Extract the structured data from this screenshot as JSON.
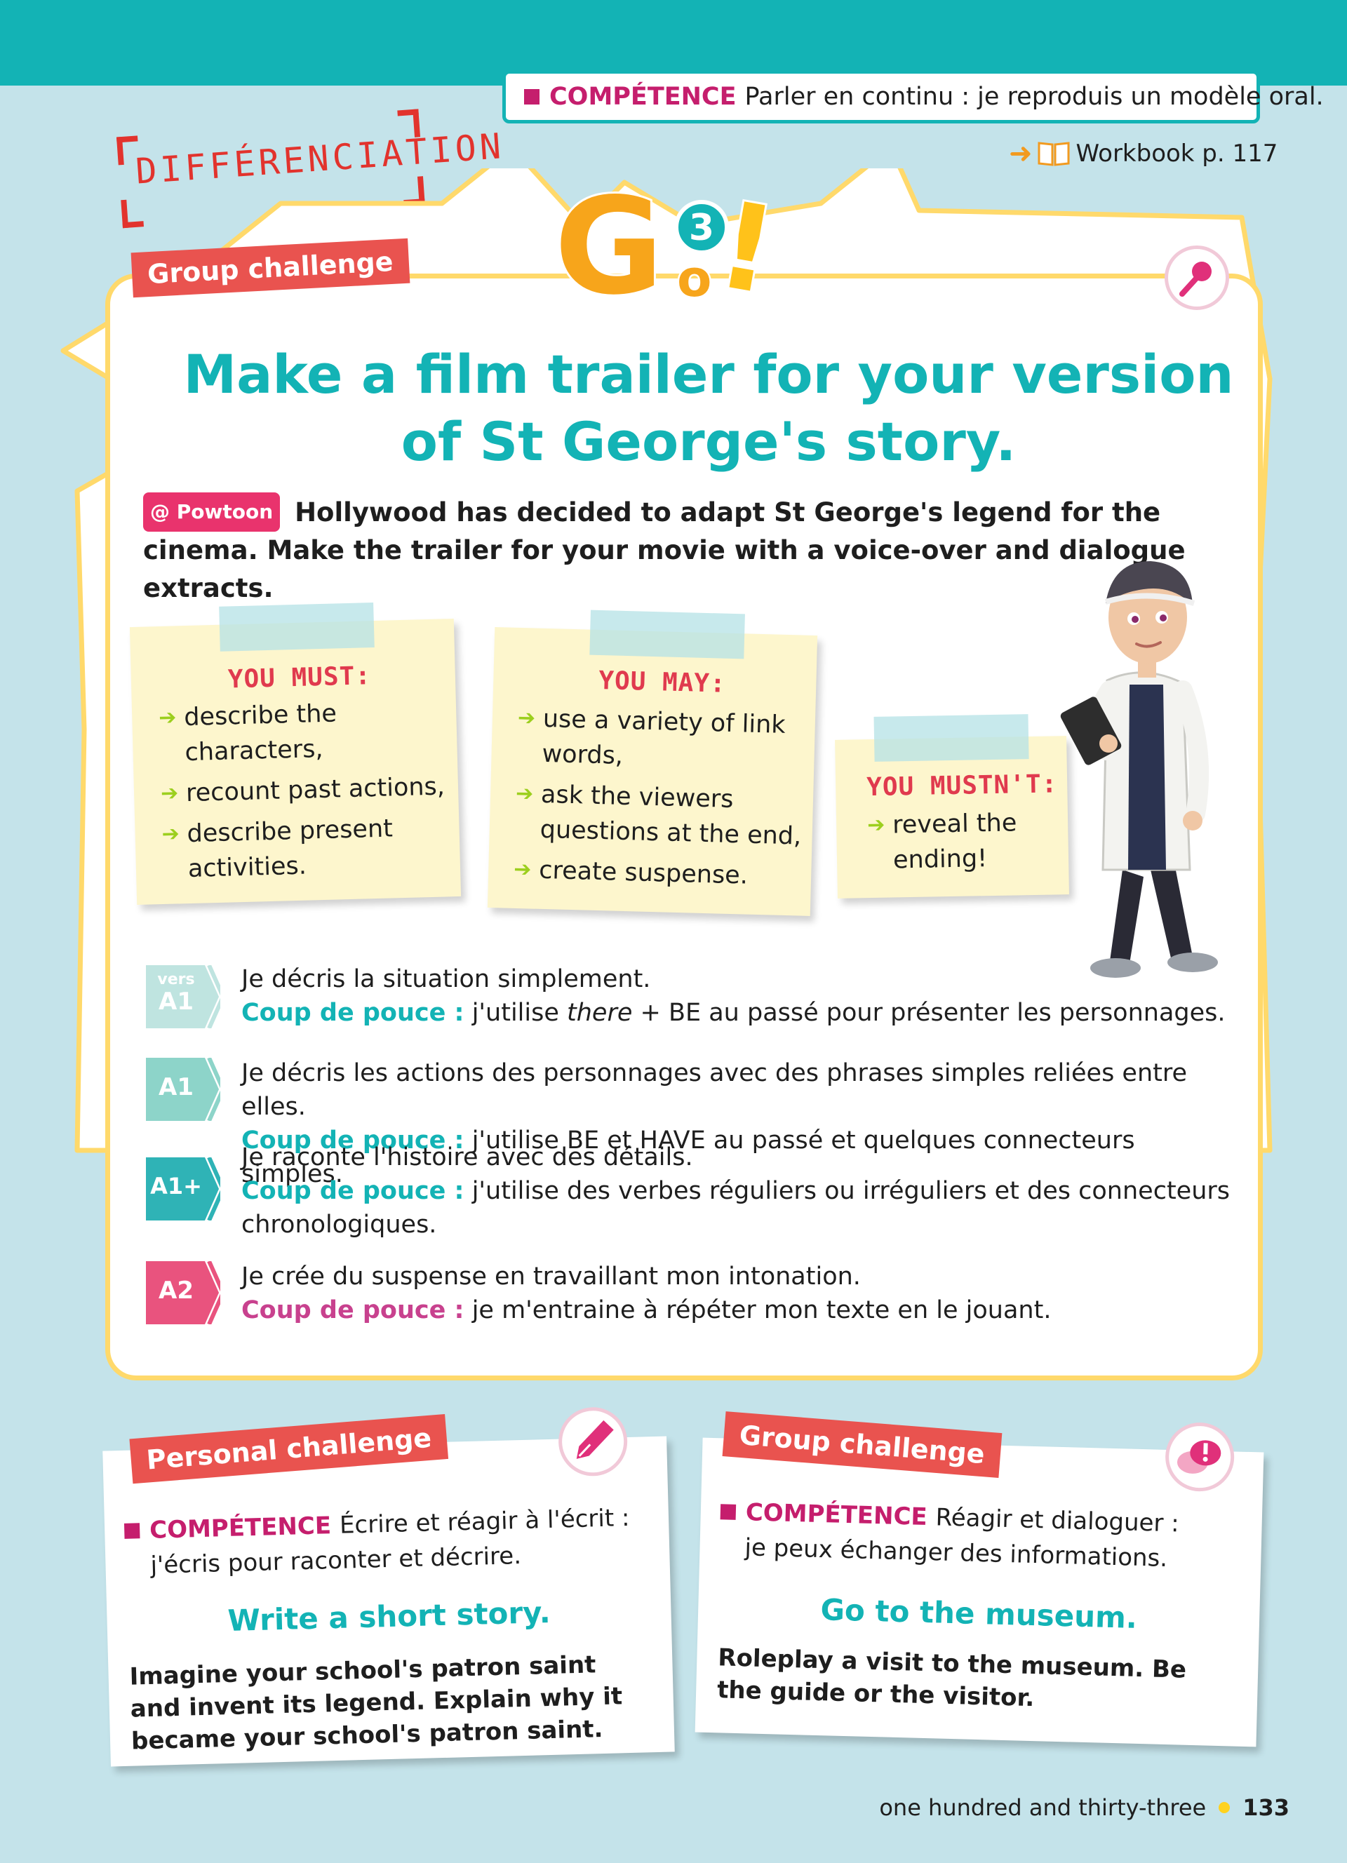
{
  "header": {
    "competence_label": "COMPÉTENCE",
    "competence_text": "Parler en continu : je reproduis un modèle oral.",
    "workbook_arrow": "➜",
    "workbook_text": "Workbook p. 117"
  },
  "differenciation": "DIFFÉRENCIATION",
  "logo": {
    "text": "Go!",
    "number": "3"
  },
  "main": {
    "tag": "Group challenge",
    "title_line1": "Make a film trailer for your version",
    "title_line2": "of St George's story.",
    "powtoon_label": "@ Powtoon",
    "intro_text": "Hollywood has decided to adapt St George's legend for the cinema. Make the trailer for your movie with a voice-over and dialogue extracts."
  },
  "notes": {
    "must": {
      "heading": "YOU MUST:",
      "items": [
        "describe the characters,",
        "recount past actions,",
        "describe present activities."
      ]
    },
    "may": {
      "heading": "YOU MAY:",
      "items": [
        "use a variety of link words,",
        "ask the viewers questions at the end,",
        "create suspense."
      ]
    },
    "mustnt": {
      "heading": "YOU MUSTN'T:",
      "items": [
        "reveal the ending!"
      ]
    }
  },
  "levels": [
    {
      "badge_top": "vers",
      "badge": "A1",
      "color": "#bfe4e0",
      "text": "Je décris la situation simplement.",
      "coup_label": "Coup de pouce :",
      "coup_pre": "j'utilise ",
      "coup_em": "there",
      "coup_post": " + BE au passé pour présenter les personnages."
    },
    {
      "badge": "A1",
      "color": "#8dd4c9",
      "text": "Je décris les actions des personnages avec des phrases simples reliées entre elles.",
      "coup_label": "Coup de pouce :",
      "coup_text": "j'utilise BE et HAVE au passé et quelques connecteurs simples."
    },
    {
      "badge": "A1+",
      "color": "#2fb3b6",
      "text": "Je raconte l'histoire avec des détails.",
      "coup_label": "Coup de pouce :",
      "coup_text": "j'utilise des verbes réguliers ou irréguliers et des connecteurs chronologiques."
    },
    {
      "badge": "A2",
      "color": "#e9537e",
      "text": "Je crée du suspense en travaillant mon intonation.",
      "coup_label": "Coup de pouce :",
      "coup_text": "je m'entraine à répéter mon texte en le jouant."
    }
  ],
  "personal_card": {
    "tag": "Personal challenge",
    "competence_label": "COMPÉTENCE",
    "competence_text1": "Écrire et réagir à l'écrit :",
    "competence_text2": "j'écris pour raconter et décrire.",
    "title": "Write a short story.",
    "body": "Imagine your school's patron saint and invent its legend. Explain why it became your school's patron saint."
  },
  "group_card": {
    "tag": "Group challenge",
    "competence_label": "COMPÉTENCE",
    "competence_text1": "Réagir et dialoguer :",
    "competence_text2": "je peux échanger des informations.",
    "title": "Go to the museum.",
    "body": "Roleplay a visit to the museum. Be the guide or the visitor."
  },
  "footer": {
    "text": "one hundred and thirty-three",
    "page_number": "133"
  },
  "colors": {
    "teal": "#13b3b5",
    "magenta": "#c51e6d",
    "tag_red": "#e9534f",
    "yellow_border": "#ffd96b",
    "background": "#c4e3ea",
    "coup_a2": "#c8418e"
  }
}
